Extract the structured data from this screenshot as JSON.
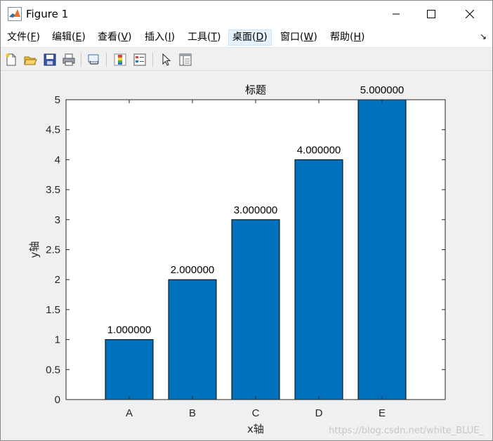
{
  "window": {
    "title": "Figure 1",
    "controls": {
      "minimize": "minimize",
      "maximize": "maximize",
      "close": "close"
    }
  },
  "menu": [
    {
      "label": "文件(",
      "key": "F",
      "tail": ")"
    },
    {
      "label": "编辑(",
      "key": "E",
      "tail": ")"
    },
    {
      "label": "查看(",
      "key": "V",
      "tail": ")"
    },
    {
      "label": "插入(",
      "key": "I",
      "tail": ")"
    },
    {
      "label": "工具(",
      "key": "T",
      "tail": ")"
    },
    {
      "label": "桌面(",
      "key": "D",
      "tail": ")"
    },
    {
      "label": "窗口(",
      "key": "W",
      "tail": ")"
    },
    {
      "label": "帮助(",
      "key": "H",
      "tail": ")"
    }
  ],
  "toolbar": [
    "new-file-icon",
    "open-folder-icon",
    "save-icon",
    "print-icon",
    "link-plot-icon",
    "colorbar-icon",
    "legend-icon",
    "pointer-icon",
    "plot-browser-icon"
  ],
  "colors": {
    "bar": "#0072bd",
    "accent_menu": "#e5f1fb"
  },
  "chart_data": {
    "type": "bar",
    "title": "标题",
    "xlabel": "x轴",
    "ylabel": "y轴",
    "categories": [
      "A",
      "B",
      "C",
      "D",
      "E"
    ],
    "values": [
      1,
      2,
      3,
      4,
      5
    ],
    "data_labels": [
      "1.000000",
      "2.000000",
      "3.000000",
      "4.000000",
      "5.000000"
    ],
    "ylim": [
      0,
      5
    ],
    "yticks": [
      "0",
      "0.5",
      "1",
      "1.5",
      "2",
      "2.5",
      "3",
      "3.5",
      "4",
      "4.5",
      "5"
    ],
    "grid": false,
    "bar_color": "#0072bd"
  },
  "watermark": "https://blog.csdn.net/white_BLUE_"
}
